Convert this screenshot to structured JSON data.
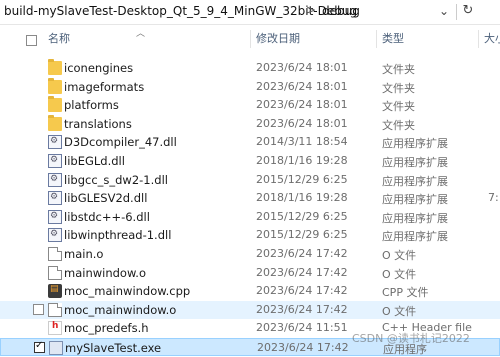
{
  "address": {
    "segments": [
      "build-mySlaveTest-Desktop_Qt_5_9_4_MinGW_32bit-Debug",
      "debug"
    ],
    "chevron": ">",
    "dropdown_icon": "chevron-down-icon",
    "refresh_icon": "refresh-icon"
  },
  "columns": {
    "name": "名称",
    "date": "修改日期",
    "type": "类型",
    "size": "大小"
  },
  "files": [
    {
      "name": "iconengines",
      "date": "2023/6/24 18:01",
      "type": "文件夹",
      "size": "",
      "icon": "folder-icon",
      "state": "normal"
    },
    {
      "name": "imageformats",
      "date": "2023/6/24 18:01",
      "type": "文件夹",
      "size": "",
      "icon": "folder-icon",
      "state": "normal"
    },
    {
      "name": "platforms",
      "date": "2023/6/24 18:01",
      "type": "文件夹",
      "size": "",
      "icon": "folder-icon",
      "state": "normal"
    },
    {
      "name": "translations",
      "date": "2023/6/24 18:01",
      "type": "文件夹",
      "size": "",
      "icon": "folder-icon",
      "state": "normal"
    },
    {
      "name": "D3Dcompiler_47.dll",
      "date": "2014/3/11 18:54",
      "type": "应用程序扩展",
      "size": "",
      "icon": "dll-icon",
      "state": "normal"
    },
    {
      "name": "libEGLd.dll",
      "date": "2018/1/16 19:28",
      "type": "应用程序扩展",
      "size": "",
      "icon": "dll-icon",
      "state": "normal"
    },
    {
      "name": "libgcc_s_dw2-1.dll",
      "date": "2015/12/29 6:25",
      "type": "应用程序扩展",
      "size": "",
      "icon": "dll-icon",
      "state": "normal"
    },
    {
      "name": "libGLESV2d.dll",
      "date": "2018/1/16 19:28",
      "type": "应用程序扩展",
      "size": "7:",
      "icon": "dll-icon",
      "state": "normal"
    },
    {
      "name": "libstdc++-6.dll",
      "date": "2015/12/29 6:25",
      "type": "应用程序扩展",
      "size": "",
      "icon": "dll-icon",
      "state": "normal"
    },
    {
      "name": "libwinpthread-1.dll",
      "date": "2015/12/29 6:25",
      "type": "应用程序扩展",
      "size": "",
      "icon": "dll-icon",
      "state": "normal"
    },
    {
      "name": "main.o",
      "date": "2023/6/24 17:42",
      "type": "O 文件",
      "size": "",
      "icon": "file-icon",
      "state": "normal"
    },
    {
      "name": "mainwindow.o",
      "date": "2023/6/24 17:42",
      "type": "O 文件",
      "size": "",
      "icon": "file-icon",
      "state": "normal"
    },
    {
      "name": "moc_mainwindow.cpp",
      "date": "2023/6/24 17:42",
      "type": "CPP 文件",
      "size": "",
      "icon": "cpp-file-icon",
      "state": "normal"
    },
    {
      "name": "moc_mainwindow.o",
      "date": "2023/6/24 17:42",
      "type": "O 文件",
      "size": "",
      "icon": "file-icon",
      "state": "hover"
    },
    {
      "name": "moc_predefs.h",
      "date": "2023/6/24 11:51",
      "type": "C++ Header file",
      "size": "",
      "icon": "header-file-icon",
      "state": "normal"
    },
    {
      "name": "mySlaveTest.exe",
      "date": "2023/6/24 17:42",
      "type": "应用程序",
      "size": "",
      "icon": "exe-icon",
      "state": "selected"
    }
  ],
  "watermark": "CSDN @读书札记2022"
}
